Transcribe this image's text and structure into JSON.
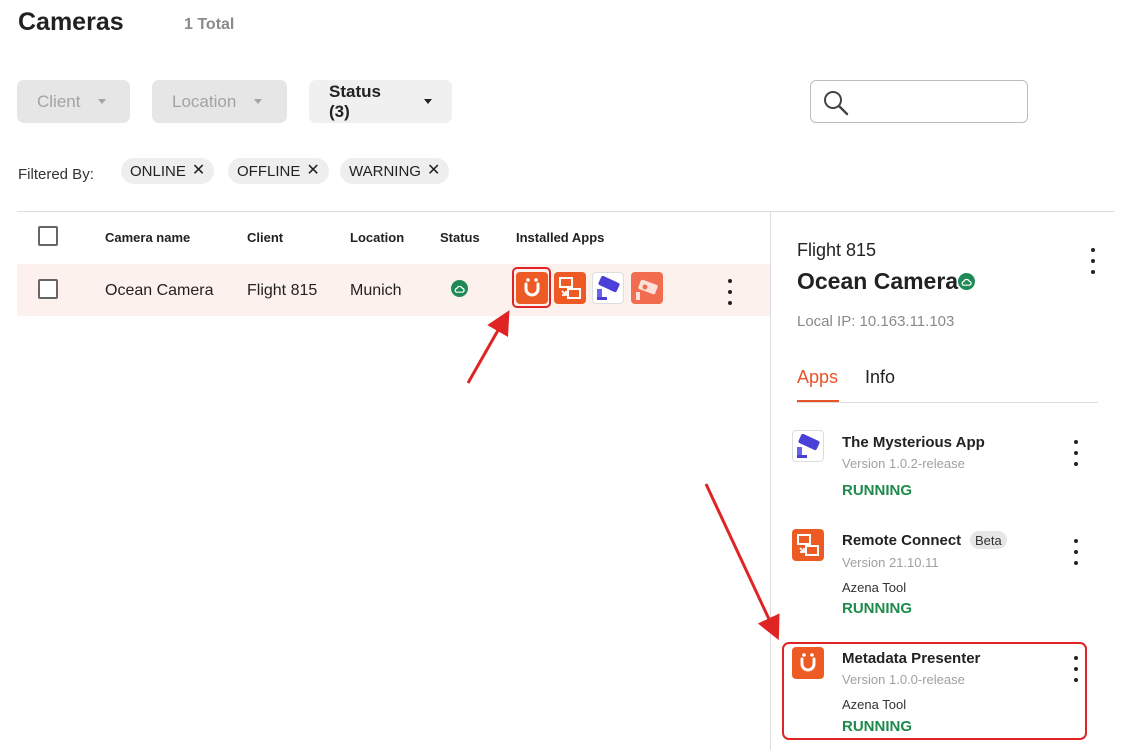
{
  "header": {
    "title": "Cameras",
    "total": "1 Total"
  },
  "filters": {
    "client_label": "Client",
    "location_label": "Location",
    "status_label": "Status (3)",
    "search_placeholder": ""
  },
  "filtered_by": {
    "label": "Filtered By:",
    "chips": [
      "ONLINE",
      "OFFLINE",
      "WARNING"
    ]
  },
  "table": {
    "columns": [
      "Camera name",
      "Client",
      "Location",
      "Status",
      "Installed Apps"
    ],
    "rows": [
      {
        "camera_name": "Ocean Camera",
        "client": "Flight 815",
        "location": "Munich",
        "status": "online",
        "installed_apps": [
          "metadata-presenter-icon",
          "remote-connect-icon",
          "mysterious-app-icon",
          "camera-app-icon"
        ]
      }
    ]
  },
  "panel": {
    "client": "Flight 815",
    "camera_name": "Ocean Camera",
    "local_ip": "Local IP: 10.163.11.103",
    "tabs": [
      "Apps",
      "Info"
    ],
    "active_tab": "Apps",
    "apps": [
      {
        "name": "The Mysterious App",
        "version": "Version 1.0.2-release",
        "tool": "",
        "status": "RUNNING",
        "badge": ""
      },
      {
        "name": "Remote Connect",
        "version": "Version 21.10.11",
        "tool": "Azena Tool",
        "status": "RUNNING",
        "badge": "Beta"
      },
      {
        "name": "Metadata Presenter",
        "version": "Version 1.0.0-release",
        "tool": "Azena Tool",
        "status": "RUNNING",
        "badge": ""
      }
    ]
  },
  "colors": {
    "accent": "#e8542a",
    "running": "#1e8a4c",
    "status_online": "#1f8a55",
    "annotation_red": "#e02424",
    "row_highlight": "#fdf1ee"
  }
}
